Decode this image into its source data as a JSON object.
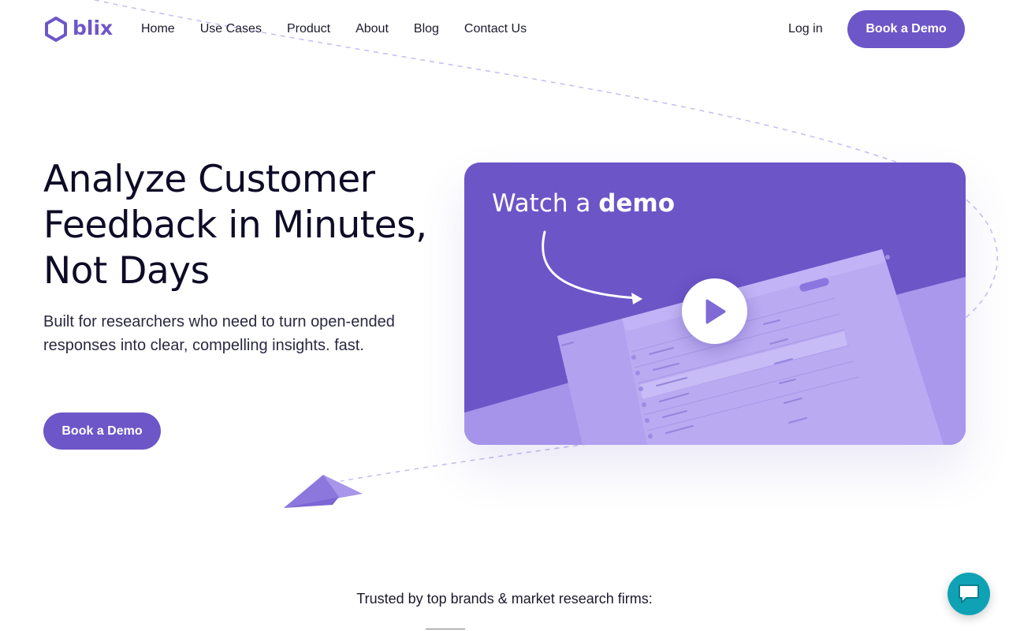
{
  "colors": {
    "brand": "#6d56c8",
    "card_background": "#6c55c7",
    "chat_button": "#0fa2b5",
    "text_dark": "#0d0b26"
  },
  "nav": {
    "logo_text": "blix",
    "links": [
      "Home",
      "Use Cases",
      "Product",
      "About",
      "Blog",
      "Contact Us"
    ],
    "login_label": "Log in",
    "cta_label": "Book a Demo"
  },
  "hero": {
    "title": "Analyze Customer Feedback in Minutes, Not Days",
    "subtitle": "Built for researchers who need to turn open-ended responses into clear, compelling insights. fast.",
    "cta_label": "Book a Demo"
  },
  "video": {
    "title_prefix": "Watch a ",
    "title_bold": "demo",
    "play_icon": "play-icon"
  },
  "trusted": {
    "text": "Trusted by top brands & market research firms:"
  },
  "chat": {
    "icon": "chat-icon"
  }
}
